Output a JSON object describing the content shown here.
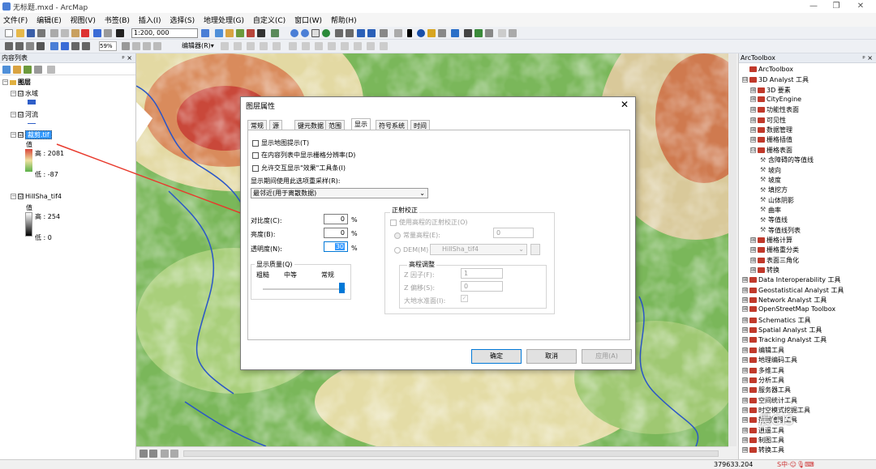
{
  "window": {
    "title": "无标题.mxd - ArcMap",
    "minimize": "—",
    "maximize": "❐",
    "close": "✕"
  },
  "menu": [
    "文件(F)",
    "编辑(E)",
    "视图(V)",
    "书签(B)",
    "插入(I)",
    "选择(S)",
    "地理处理(G)",
    "自定义(C)",
    "窗口(W)",
    "帮助(H)"
  ],
  "toolbar": {
    "scale": "1:200, 000",
    "zoom": "59%",
    "editor": "编辑器(R)▾"
  },
  "toc": {
    "header": "内容列表",
    "pin": "ᵖ ×",
    "root": "图层",
    "layers": [
      {
        "name": "水域",
        "checked": "☑"
      },
      {
        "name": "河流",
        "checked": "☑"
      },
      {
        "name": "裁剪.tif",
        "checked": "☑",
        "value_label": "值",
        "high": "高 : 2081",
        "low": "低 : -87"
      },
      {
        "name": "HillSha_tif4",
        "checked": "☑",
        "value_label": "值",
        "high": "高 : 254",
        "low": "低 : 0"
      }
    ]
  },
  "toolbox": {
    "header": "ArcToolbox",
    "pin": "ᵖ ×",
    "items": [
      {
        "label": "ArcToolbox",
        "level": 0,
        "kind": "root"
      },
      {
        "label": "3D Analyst 工具",
        "level": 1,
        "kind": "box",
        "exp": "⊟"
      },
      {
        "label": "3D 要素",
        "level": 2,
        "kind": "box",
        "exp": "⊞"
      },
      {
        "label": "CityEngine",
        "level": 2,
        "kind": "box",
        "exp": "⊞"
      },
      {
        "label": "功能性表面",
        "level": 2,
        "kind": "box",
        "exp": "⊞"
      },
      {
        "label": "可见性",
        "level": 2,
        "kind": "box",
        "exp": "⊞"
      },
      {
        "label": "数据管理",
        "level": 2,
        "kind": "box",
        "exp": "⊞"
      },
      {
        "label": "栅格插值",
        "level": 2,
        "kind": "box",
        "exp": "⊞"
      },
      {
        "label": "栅格表面",
        "level": 2,
        "kind": "box",
        "exp": "⊟"
      },
      {
        "label": "含障碍的等值线",
        "level": 3,
        "kind": "tool"
      },
      {
        "label": "坡向",
        "level": 3,
        "kind": "tool"
      },
      {
        "label": "坡度",
        "level": 3,
        "kind": "tool"
      },
      {
        "label": "填挖方",
        "level": 3,
        "kind": "tool"
      },
      {
        "label": "山体阴影",
        "level": 3,
        "kind": "tool"
      },
      {
        "label": "曲率",
        "level": 3,
        "kind": "tool"
      },
      {
        "label": "等值线",
        "level": 3,
        "kind": "tool"
      },
      {
        "label": "等值线列表",
        "level": 3,
        "kind": "tool"
      },
      {
        "label": "栅格计算",
        "level": 2,
        "kind": "box",
        "exp": "⊞"
      },
      {
        "label": "栅格重分类",
        "level": 2,
        "kind": "box",
        "exp": "⊞"
      },
      {
        "label": "表面三角化",
        "level": 2,
        "kind": "box",
        "exp": "⊞"
      },
      {
        "label": "转换",
        "level": 2,
        "kind": "box",
        "exp": "⊞"
      },
      {
        "label": "Data Interoperability 工具",
        "level": 1,
        "kind": "box",
        "exp": "⊞"
      },
      {
        "label": "Geostatistical Analyst 工具",
        "level": 1,
        "kind": "box",
        "exp": "⊞"
      },
      {
        "label": "Network Analyst 工具",
        "level": 1,
        "kind": "box",
        "exp": "⊞"
      },
      {
        "label": "OpenStreetMap Toolbox",
        "level": 1,
        "kind": "box",
        "exp": "⊞"
      },
      {
        "label": "Schematics 工具",
        "level": 1,
        "kind": "box",
        "exp": "⊞"
      },
      {
        "label": "Spatial Analyst 工具",
        "level": 1,
        "kind": "box",
        "exp": "⊞"
      },
      {
        "label": "Tracking Analyst 工具",
        "level": 1,
        "kind": "box",
        "exp": "⊞"
      },
      {
        "label": "编辑工具",
        "level": 1,
        "kind": "box",
        "exp": "⊞"
      },
      {
        "label": "地理编码工具",
        "level": 1,
        "kind": "box",
        "exp": "⊞"
      },
      {
        "label": "多维工具",
        "level": 1,
        "kind": "box",
        "exp": "⊞"
      },
      {
        "label": "分析工具",
        "level": 1,
        "kind": "box",
        "exp": "⊞"
      },
      {
        "label": "服务器工具",
        "level": 1,
        "kind": "box",
        "exp": "⊞"
      },
      {
        "label": "空间统计工具",
        "level": 1,
        "kind": "box",
        "exp": "⊞"
      },
      {
        "label": "时空模式挖掘工具",
        "level": 1,
        "kind": "box",
        "exp": "⊞"
      },
      {
        "label": "数据管理工具",
        "level": 1,
        "kind": "box",
        "exp": "⊞"
      },
      {
        "label": "逍遥工具",
        "level": 1,
        "kind": "box",
        "exp": "⊞"
      },
      {
        "label": "制图工具",
        "level": 1,
        "kind": "box",
        "exp": "⊞"
      },
      {
        "label": "转换工具",
        "level": 1,
        "kind": "box",
        "exp": "⊞"
      }
    ]
  },
  "dialog": {
    "title": "图层属性",
    "close": "✕",
    "tabs": [
      "常规",
      "源",
      "键元数据",
      "范围",
      "显示",
      "符号系统",
      "时间"
    ],
    "active_tab": "显示",
    "opt1": "显示地图提示(T)",
    "opt2": "在内容列表中显示栅格分辨率(D)",
    "opt3": "允许交互显示\"效果\"工具条(I)",
    "resample_label": "显示期间使用此选项重采样(R):",
    "resample_value": "最邻近(用于离散数据)",
    "contrast_label": "对比度(C):",
    "contrast_value": "0",
    "brightness_label": "亮度(B):",
    "brightness_value": "0",
    "transparency_label": "透明度(N):",
    "transparency_value": "30",
    "pct": "%",
    "quality_title": "显示质量(Q)",
    "q_coarse": "粗糙",
    "q_medium": "中等",
    "q_normal": "常规",
    "ortho_title": "正射校正",
    "use_elev": "使用高程的正射校正(O)",
    "const_elev": "常量高程(E):",
    "const_elev_value": "0",
    "dem_label": "DEM(M)",
    "dem_value": "HillSha_tif4",
    "elev_adj_title": "高程调整",
    "z_factor": "Z 因子(F):",
    "z_factor_value": "1",
    "z_offset": "Z 偏移(S):",
    "z_offset_value": "0",
    "geoid": "大地水准面(I):",
    "ok": "确定",
    "cancel": "取消",
    "apply": "应用(A)"
  },
  "status": {
    "coords": "379633.204",
    "watermark": "晨GIS"
  },
  "colors": {
    "arrow": "#e8392c",
    "highlight": "#3399ff",
    "accent": "#0078d7"
  }
}
